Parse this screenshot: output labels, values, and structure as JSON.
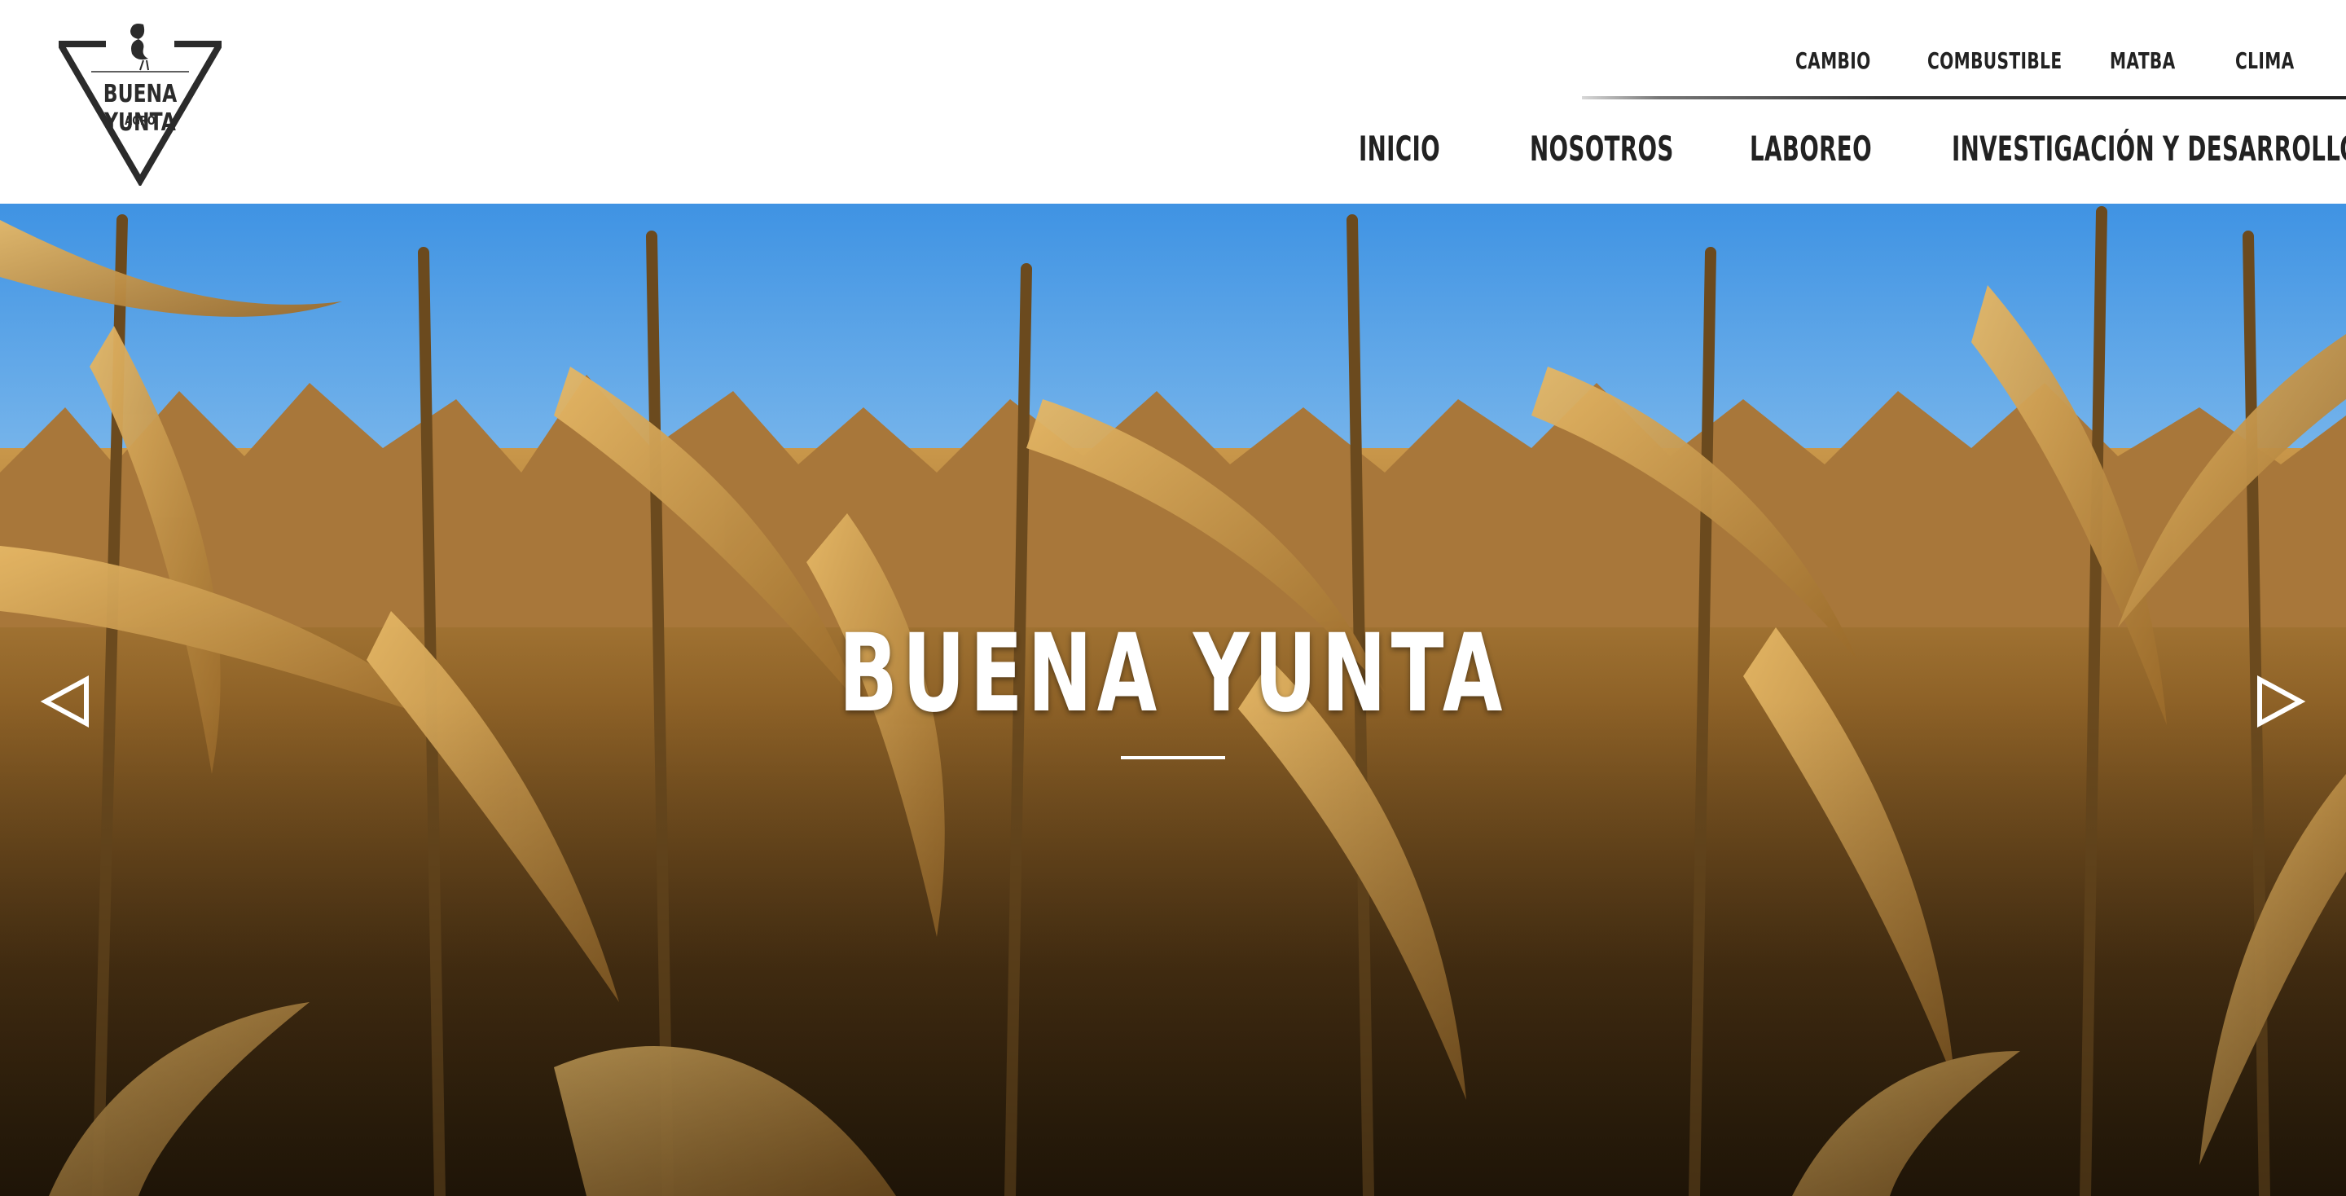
{
  "logo": {
    "name": "BUENA YUNTA",
    "sub": "AGRO",
    "icon": "heron-triangle-logo"
  },
  "topnav": [
    {
      "label": "CAMBIO"
    },
    {
      "label": "COMBUSTIBLE"
    },
    {
      "label": "MATBA"
    },
    {
      "label": "CLIMA"
    }
  ],
  "mainnav": [
    {
      "label": "INICIO"
    },
    {
      "label": "NOSOTROS"
    },
    {
      "label": "LABOREO"
    },
    {
      "label": "INVESTIGACIÓN Y DESARROLLO"
    }
  ],
  "hero": {
    "title": "BUENA YUNTA",
    "image": "corn-field-photo",
    "prev_icon": "triangle-left-icon",
    "next_icon": "triangle-right-icon"
  },
  "colors": {
    "text": "#222222",
    "sky": "#5aa7ea",
    "crop": "#b8873f",
    "white": "#ffffff"
  }
}
